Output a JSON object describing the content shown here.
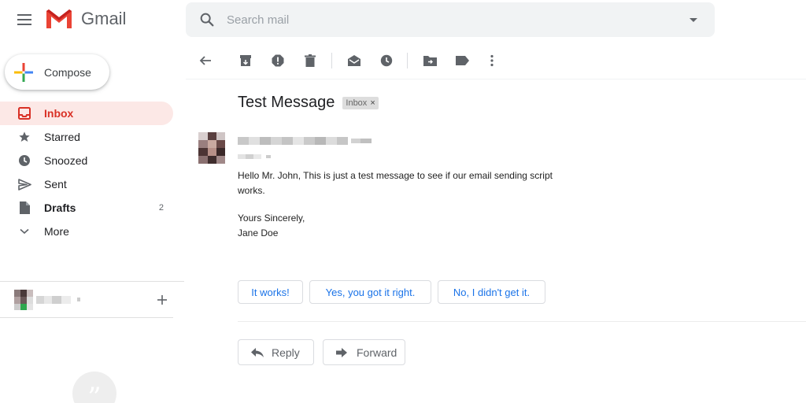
{
  "app": {
    "name": "Gmail"
  },
  "search": {
    "placeholder": "Search mail"
  },
  "compose": {
    "label": "Compose"
  },
  "sidebar": {
    "items": [
      {
        "label": "Inbox",
        "icon": "inbox-icon",
        "active": true
      },
      {
        "label": "Starred",
        "icon": "star-icon"
      },
      {
        "label": "Snoozed",
        "icon": "clock-icon"
      },
      {
        "label": "Sent",
        "icon": "send-icon"
      },
      {
        "label": "Drafts",
        "icon": "draft-icon",
        "count": "2"
      },
      {
        "label": "More",
        "icon": "chevron-down-icon"
      }
    ]
  },
  "toolbar": {
    "icons": [
      "back-icon",
      "archive-icon",
      "report-spam-icon",
      "delete-icon",
      "mark-unread-icon",
      "snooze-icon",
      "move-to-icon",
      "label-icon",
      "more-vert-icon"
    ]
  },
  "message": {
    "subject": "Test Message",
    "label_chip": "Inbox",
    "label_chip_close": "×",
    "body": "Hello Mr. John, This is just a test message to see if our email sending script works.",
    "sign_off": "Yours Sincerely,",
    "signature": "Jane Doe"
  },
  "smart_replies": [
    "It works!",
    "Yes, you got it right.",
    "No, I didn't get it."
  ],
  "actions": {
    "reply": "Reply",
    "forward": "Forward"
  },
  "colors": {
    "accent_red": "#d93025",
    "active_bg": "#fce8e6",
    "link_blue": "#1a73e8",
    "gmail_red": "#ea4335"
  }
}
